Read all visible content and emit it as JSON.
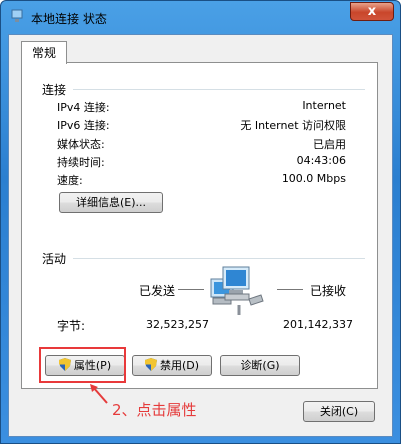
{
  "window": {
    "title": "本地连接 状态",
    "close_label": "x"
  },
  "tab": {
    "label": "常规"
  },
  "connection": {
    "header": "连接",
    "rows": [
      {
        "label": "IPv4 连接:",
        "value": "Internet"
      },
      {
        "label": "IPv6 连接:",
        "value": "无 Internet 访问权限"
      },
      {
        "label": "媒体状态:",
        "value": "已启用"
      },
      {
        "label": "持续时间:",
        "value": "04:43:06"
      },
      {
        "label": "速度:",
        "value": "100.0 Mbps"
      }
    ],
    "details_button": "详细信息(E)..."
  },
  "activity": {
    "header": "活动",
    "sent_label": "已发送",
    "received_label": "已接收",
    "bytes_label": "字节:",
    "bytes_sent": "32,523,257",
    "bytes_received": "201,142,337"
  },
  "buttons": {
    "properties": "属性(P)",
    "disable": "禁用(D)",
    "diagnose": "诊断(G)",
    "close": "关闭(C)"
  },
  "annotation": {
    "text": "2、点击属性",
    "color": "#e53b3b"
  }
}
